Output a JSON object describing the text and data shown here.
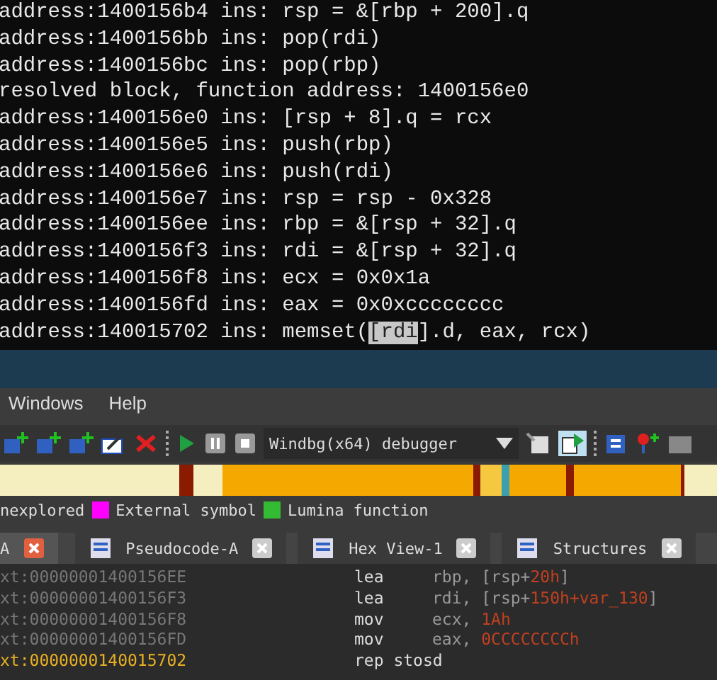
{
  "terminal": {
    "lines": [
      {
        "parts": [
          {
            "text": "address:1400156b4 ins: rsp = &[rbp + 200].q",
            "selected": false
          }
        ]
      },
      {
        "parts": [
          {
            "text": "address:1400156bb ins: pop(rdi)",
            "selected": false
          }
        ]
      },
      {
        "parts": [
          {
            "text": "address:1400156bc ins: pop(rbp)",
            "selected": false
          }
        ]
      },
      {
        "parts": [
          {
            "text": "resolved block, function address: 1400156e0",
            "selected": false
          }
        ]
      },
      {
        "parts": [
          {
            "text": "address:1400156e0 ins: [rsp + 8].q = rcx",
            "selected": false
          }
        ]
      },
      {
        "parts": [
          {
            "text": "address:1400156e5 ins: push(rbp)",
            "selected": false
          }
        ]
      },
      {
        "parts": [
          {
            "text": "address:1400156e6 ins: push(rdi)",
            "selected": false
          }
        ]
      },
      {
        "parts": [
          {
            "text": "address:1400156e7 ins: rsp = rsp - 0x328",
            "selected": false
          }
        ]
      },
      {
        "parts": [
          {
            "text": "address:1400156ee ins: rbp = &[rsp + 32].q",
            "selected": false
          }
        ]
      },
      {
        "parts": [
          {
            "text": "address:1400156f3 ins: rdi = &[rsp + 32].q",
            "selected": false
          }
        ]
      },
      {
        "parts": [
          {
            "text": "address:1400156f8 ins: ecx = 0x0x1a",
            "selected": false
          }
        ]
      },
      {
        "parts": [
          {
            "text": "address:1400156fd ins: eax = 0x0xcccccccc",
            "selected": false
          }
        ]
      },
      {
        "parts": [
          {
            "text": "address:140015702 ins: memset(",
            "selected": false
          },
          {
            "text": "[rdi",
            "selected": true
          },
          {
            "text": "].d, eax, rcx)",
            "selected": false
          }
        ]
      }
    ]
  },
  "menu": [
    "Windows",
    "Help"
  ],
  "toolbar": {
    "debugger": "Windbg(x64) debugger"
  },
  "legend": [
    {
      "label": "nexplored"
    },
    {
      "label": "External symbol",
      "color": "#ff00ff"
    },
    {
      "label": "Lumina function",
      "color": "#33bb33"
    }
  ],
  "tabs": [
    {
      "label": "A",
      "selected": true
    },
    {
      "label": "Pseudocode-A",
      "selected": false
    },
    {
      "label": "Hex View-1",
      "selected": false
    },
    {
      "label": "Structures",
      "selected": false
    }
  ],
  "disassembly": [
    {
      "address": "xt:00000001400156EE",
      "mnemonic": "lea",
      "operands": [
        {
          "text": "rbp, [rsp+",
          "kind": "reg"
        },
        {
          "text": "20h",
          "kind": "num"
        },
        {
          "text": "]",
          "kind": "reg"
        }
      ],
      "selected": false
    },
    {
      "address": "xt:00000001400156F3",
      "mnemonic": "lea",
      "operands": [
        {
          "text": "rdi, [rsp+",
          "kind": "reg"
        },
        {
          "text": "150h+var_130",
          "kind": "num"
        },
        {
          "text": "]",
          "kind": "reg"
        }
      ],
      "selected": false
    },
    {
      "address": "xt:00000001400156F8",
      "mnemonic": "mov",
      "operands": [
        {
          "text": "ecx, ",
          "kind": "reg"
        },
        {
          "text": "1Ah",
          "kind": "num"
        }
      ],
      "selected": false
    },
    {
      "address": "xt:00000001400156FD",
      "mnemonic": "mov",
      "operands": [
        {
          "text": "eax, ",
          "kind": "reg"
        },
        {
          "text": "0CCCCCCCCh",
          "kind": "num"
        }
      ],
      "selected": false
    },
    {
      "address": "xt:0000000140015702",
      "mnemonic": "rep stosd",
      "selected": true
    }
  ]
}
